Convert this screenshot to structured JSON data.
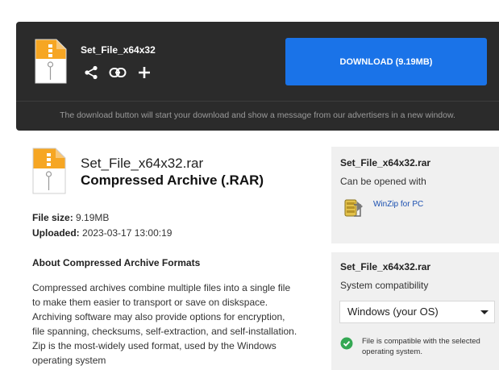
{
  "header": {
    "filename": "Set_File_x64x32",
    "download_label": "DOWNLOAD (9.19MB)",
    "notice": "The download button will start your download and show a message from our advertisers in a new window.",
    "icons": [
      "file-zip-icon",
      "share-icon",
      "link-icon",
      "plus-icon"
    ]
  },
  "main": {
    "filename": "Set_File_x64x32.rar",
    "type": "Compressed Archive (.RAR)",
    "size_label": "File size:",
    "size_value": "9.19MB",
    "uploaded_label": "Uploaded:",
    "uploaded_value": "2023-03-17 13:00:19",
    "about_title": "About Compressed Archive Formats",
    "about_text": "Compressed archives combine multiple files into a single file to make them easier to transport or save on diskspace. Archiving software may also provide options for encryption, file spanning, checksums, self-extraction, and self-installation. Zip is the most-widely used format, used by the Windows operating system"
  },
  "panel_open": {
    "filename": "Set_File_x64x32.rar",
    "subtitle": "Can be opened with",
    "app_label": "WinZip for PC"
  },
  "panel_compat": {
    "filename": "Set_File_x64x32.rar",
    "subtitle": "System compatibility",
    "os_selected": "Windows (your OS)",
    "compat_text": "File is compatible with the selected operating system."
  },
  "colors": {
    "accent": "#1a73e8",
    "header_bg": "#2b2b2b",
    "panel_bg": "#f0f0f0",
    "ok_green": "#34a853",
    "zip_orange": "#f5a623"
  }
}
